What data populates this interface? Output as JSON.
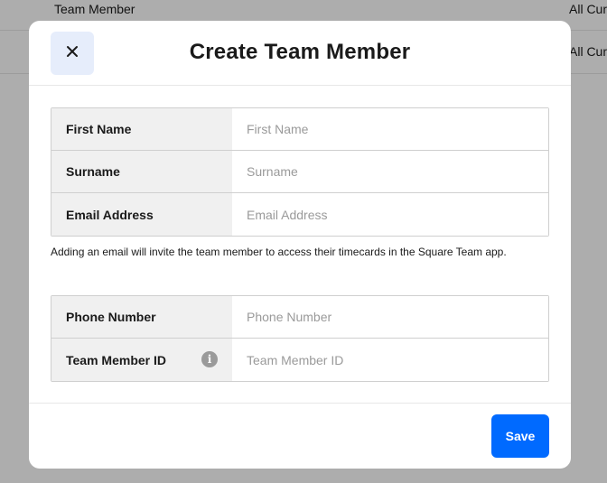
{
  "background": {
    "rows": [
      {
        "name": "Team Member",
        "value": "All Cur"
      },
      {
        "name": "",
        "value": "All Cur"
      }
    ]
  },
  "modal": {
    "title": "Create Team Member",
    "close_icon": "close-icon",
    "group1": [
      {
        "label": "First Name",
        "placeholder": "First Name",
        "value": ""
      },
      {
        "label": "Surname",
        "placeholder": "Surname",
        "value": ""
      },
      {
        "label": "Email Address",
        "placeholder": "Email Address",
        "value": ""
      }
    ],
    "helper_text": "Adding an email will invite the team member to access their timecards in the Square Team app.",
    "group2": [
      {
        "label": "Phone Number",
        "placeholder": "Phone Number",
        "value": ""
      },
      {
        "label": "Team Member ID",
        "placeholder": "Team Member ID",
        "value": "",
        "info_icon": "info-icon"
      }
    ],
    "save_label": "Save"
  },
  "colors": {
    "accent": "#006aff",
    "close_bg": "#e6edfb",
    "label_bg": "#f0f0f0"
  }
}
